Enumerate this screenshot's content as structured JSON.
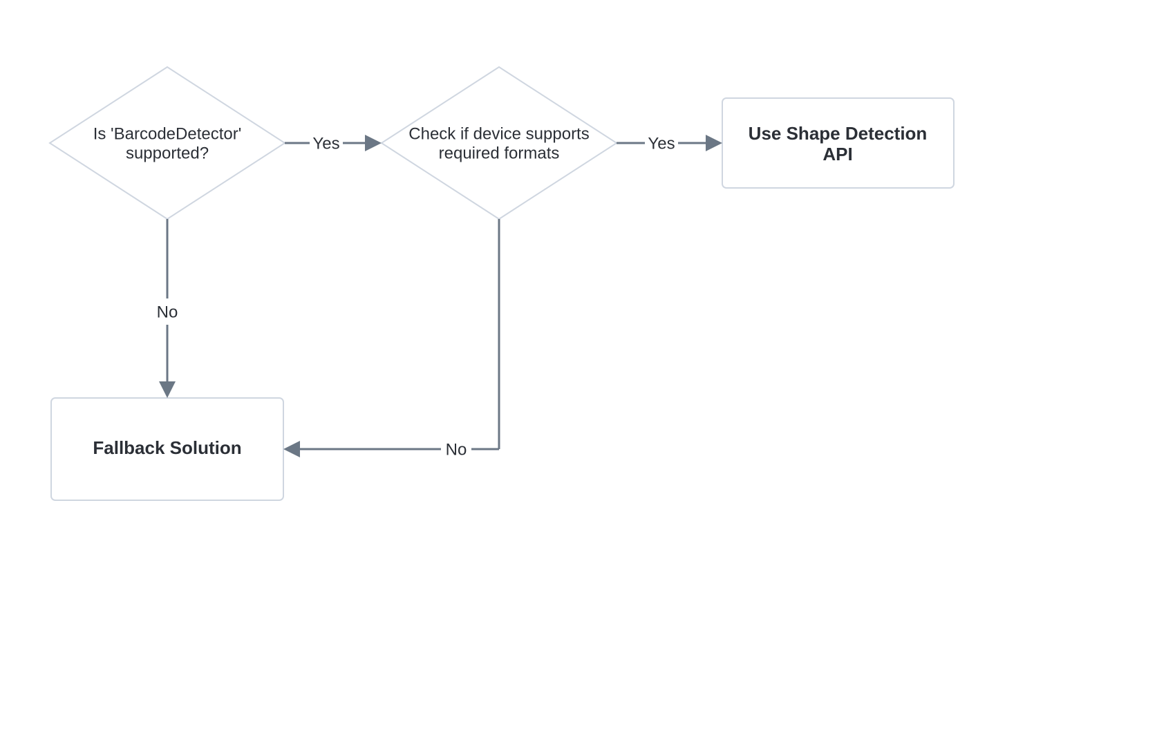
{
  "nodes": {
    "decision1": {
      "line1": "Is 'BarcodeDetector'",
      "line2": "supported?"
    },
    "decision2": {
      "line1": "Check if device supports",
      "line2": "required formats"
    },
    "result1": {
      "line1": "Use Shape Detection",
      "line2": "API"
    },
    "result2": {
      "line1": "Fallback Solution"
    }
  },
  "edges": {
    "d1_yes": "Yes",
    "d1_no": "No",
    "d2_yes": "Yes",
    "d2_no": "No"
  },
  "colors": {
    "nodeStroke": "#cfd6e0",
    "edge": "#6b7785",
    "text": "#2b2f36",
    "bg": "#ffffff"
  }
}
